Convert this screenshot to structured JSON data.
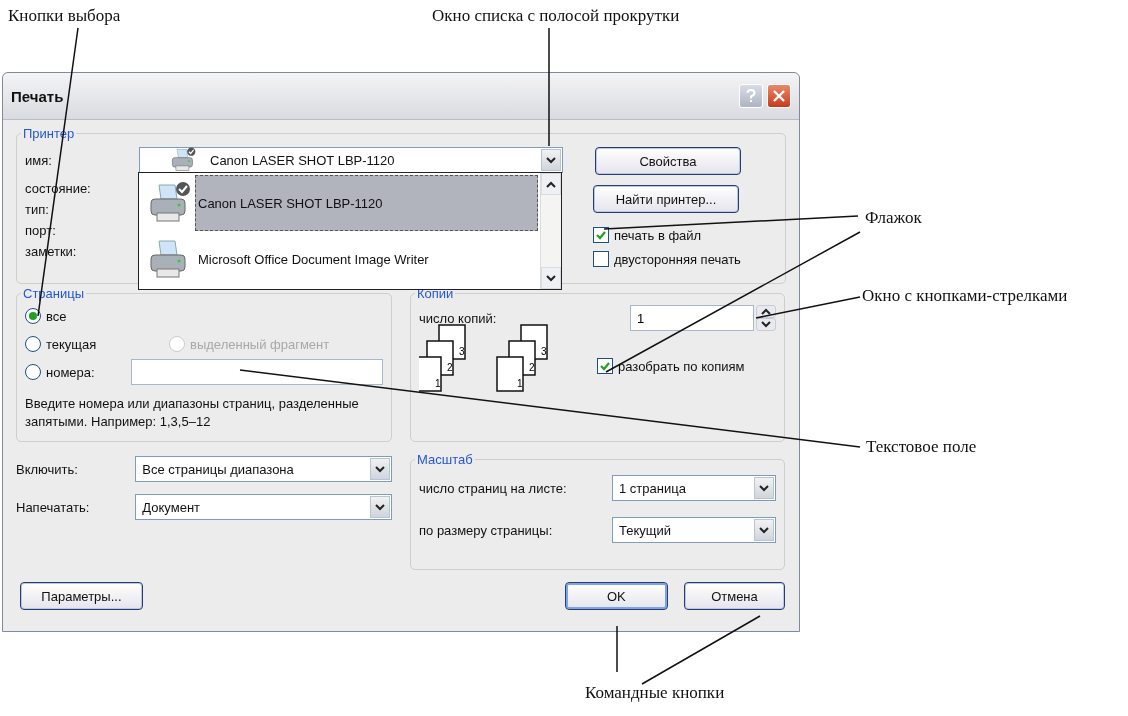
{
  "window": {
    "title": "Печать"
  },
  "printer": {
    "title": "Принтер",
    "labels": [
      "имя:",
      "состояние:",
      "тип:",
      "порт:",
      "заметки:"
    ],
    "name": "Canon LASER SHOT LBP-1120",
    "list": [
      {
        "label": "Canon LASER SHOT LBP-1120",
        "selected": true,
        "is_default": true
      },
      {
        "label": "Microsoft Office Document Image Writer",
        "selected": false,
        "is_default": false
      }
    ],
    "buttons": [
      "Свойства",
      "Найти принтер..."
    ],
    "options": [
      {
        "label": "печать в файл",
        "checked": true
      },
      {
        "label": "двусторонняя печать",
        "checked": false
      }
    ]
  },
  "pages": {
    "title": "Страницы",
    "radios": [
      {
        "label": "все",
        "selected": true,
        "disabled": false
      },
      {
        "label": "текущая",
        "selected": false,
        "disabled": false
      },
      {
        "label": "выделенный фрагмент",
        "selected": false,
        "disabled": true
      },
      {
        "label": "номера:",
        "selected": false,
        "disabled": false
      }
    ],
    "hint": "Введите номера или диапазоны страниц, разделенные запятыми. Например: 1,3,5–12"
  },
  "selects": [
    {
      "label": "Включить:",
      "value": "Все страницы диапазона"
    },
    {
      "label": "Напечатать:",
      "value": "Документ"
    }
  ],
  "copies": {
    "title": "Копии",
    "label": "число копий:",
    "value": "1",
    "collate": {
      "label": "разобрать по копиям",
      "checked": true
    },
    "stacks": [
      [
        "3",
        "2",
        "1"
      ],
      [
        "3",
        "2",
        "1"
      ]
    ]
  },
  "scale": {
    "title": "Масштаб",
    "rows": [
      {
        "label": "число страниц на листе:",
        "value": "1 страница"
      },
      {
        "label": "по размеру страницы:",
        "value": "Текущий"
      }
    ]
  },
  "buttons": [
    {
      "label": "Параметры...",
      "default": false
    },
    {
      "label": "OK",
      "default": true
    },
    {
      "label": "Отмена",
      "default": false
    }
  ],
  "callouts": [
    {
      "text": "Кнопки выбора"
    },
    {
      "text": "Окно списка с полосой прокрутки"
    },
    {
      "text": "Флажок"
    },
    {
      "text": "Окно с кнопками-стрелками"
    },
    {
      "text": "Текстовое поле"
    },
    {
      "text": "Командные кнопки"
    }
  ]
}
